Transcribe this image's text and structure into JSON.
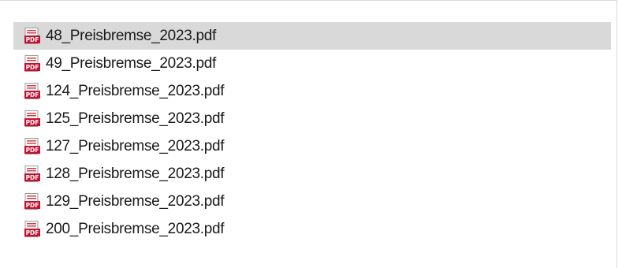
{
  "file_list": {
    "items": [
      {
        "name": "48_Preisbremse_2023.pdf",
        "icon": "pdf-file-icon",
        "selected": true
      },
      {
        "name": "49_Preisbremse_2023.pdf",
        "icon": "pdf-file-icon",
        "selected": false
      },
      {
        "name": "124_Preisbremse_2023.pdf",
        "icon": "pdf-file-icon",
        "selected": false
      },
      {
        "name": "125_Preisbremse_2023.pdf",
        "icon": "pdf-file-icon",
        "selected": false
      },
      {
        "name": "127_Preisbremse_2023.pdf",
        "icon": "pdf-file-icon",
        "selected": false
      },
      {
        "name": "128_Preisbremse_2023.pdf",
        "icon": "pdf-file-icon",
        "selected": false
      },
      {
        "name": "129_Preisbremse_2023.pdf",
        "icon": "pdf-file-icon",
        "selected": false
      },
      {
        "name": "200_Preisbremse_2023.pdf",
        "icon": "pdf-file-icon",
        "selected": false
      }
    ]
  },
  "colors": {
    "selection_background": "#d9d9d9",
    "pdf_icon_red": "#c8102e",
    "text": "#1a1a1a"
  }
}
